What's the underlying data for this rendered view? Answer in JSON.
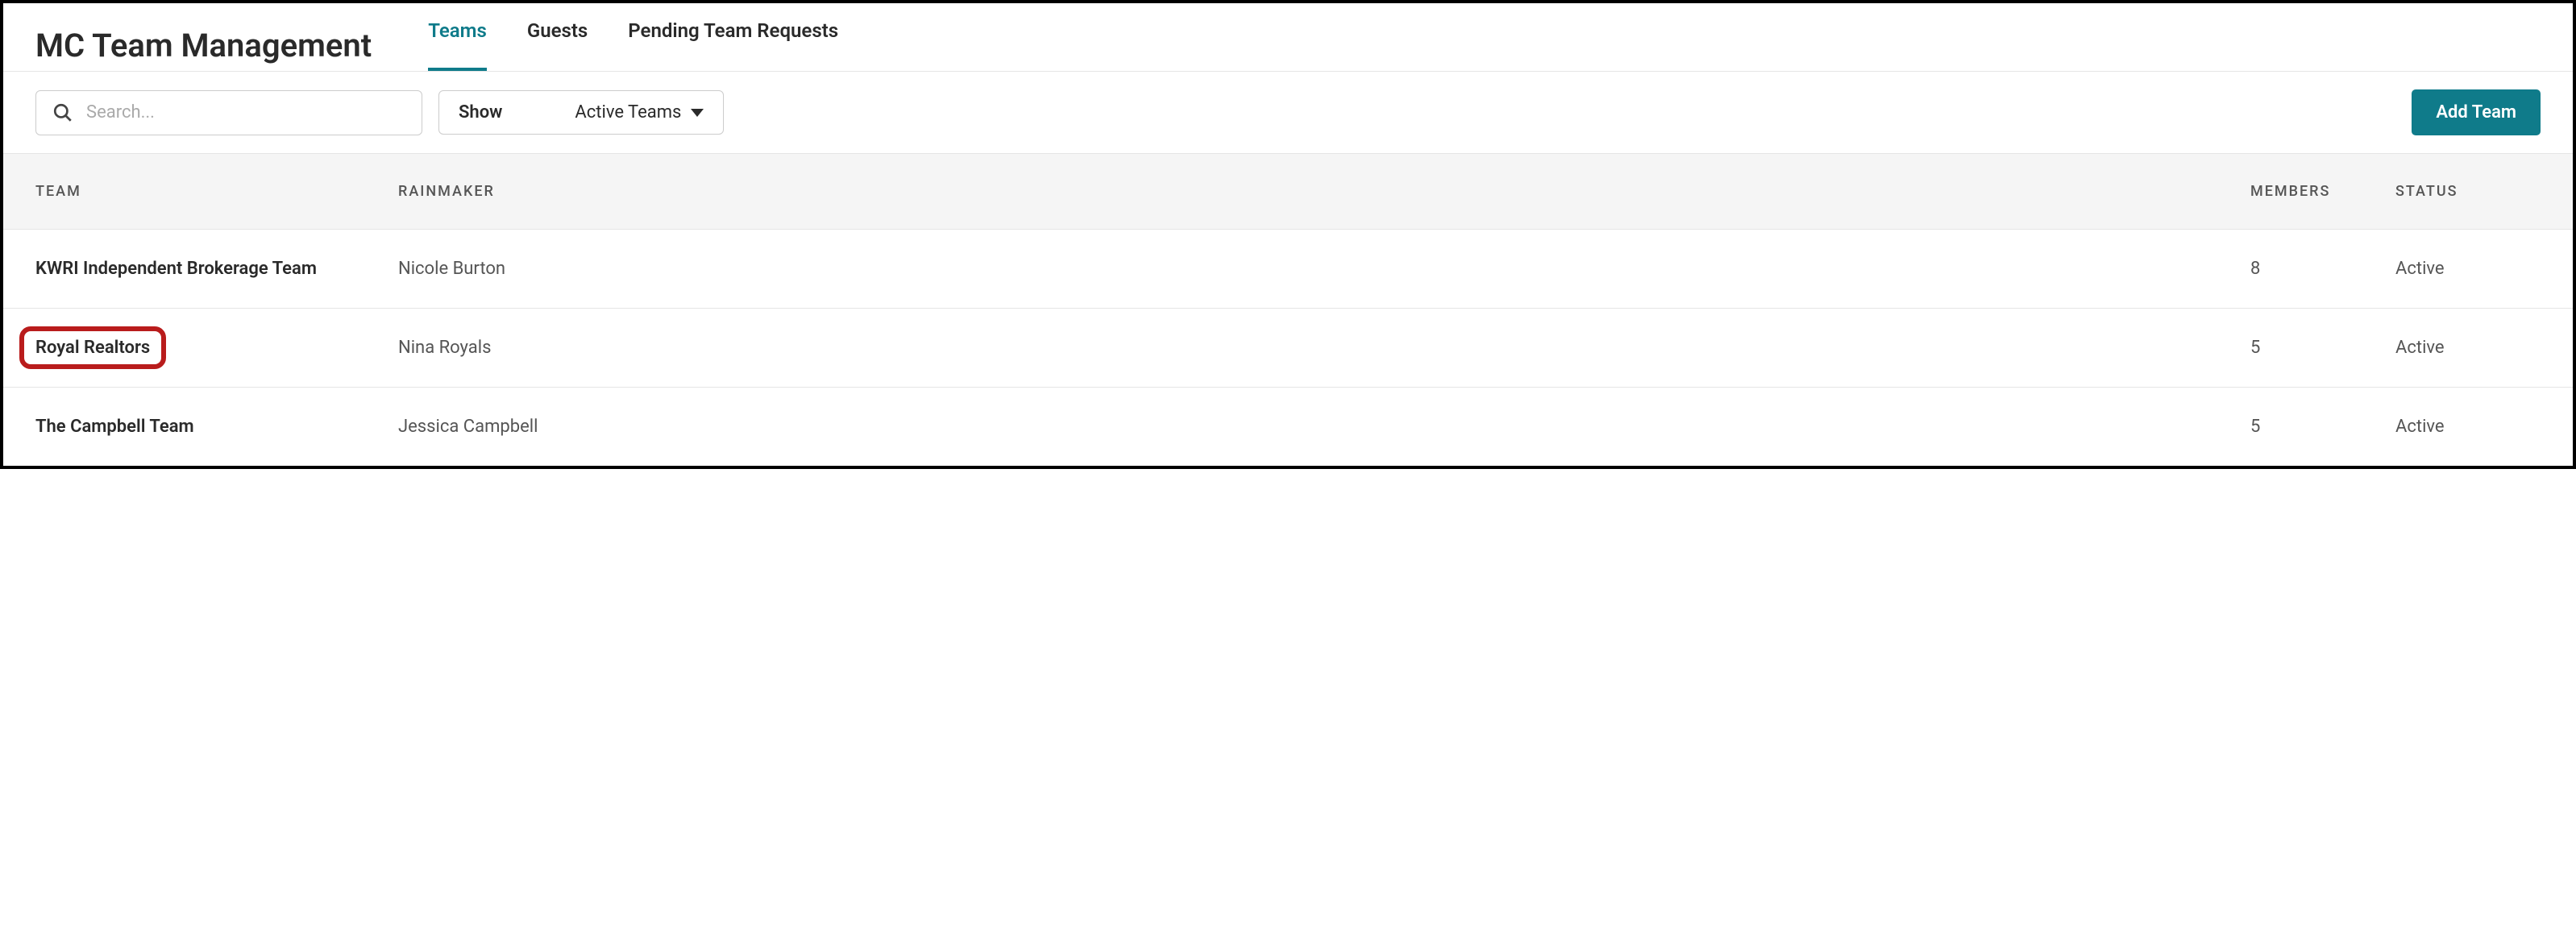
{
  "header": {
    "title": "MC Team Management",
    "tabs": [
      {
        "label": "Teams",
        "active": true
      },
      {
        "label": "Guests",
        "active": false
      },
      {
        "label": "Pending Team Requests",
        "active": false
      }
    ]
  },
  "controls": {
    "search_placeholder": "Search...",
    "filter_label": "Show",
    "filter_value": "Active Teams",
    "add_button_label": "Add Team"
  },
  "table": {
    "columns": {
      "team": "TEAM",
      "rainmaker": "RAINMAKER",
      "members": "MEMBERS",
      "status": "STATUS"
    },
    "rows": [
      {
        "team": "KWRI Independent Brokerage Team",
        "rainmaker": "Nicole Burton",
        "members": "8",
        "status": "Active",
        "highlighted": false
      },
      {
        "team": "Royal Realtors",
        "rainmaker": "Nina Royals",
        "members": "5",
        "status": "Active",
        "highlighted": true
      },
      {
        "team": "The Campbell Team",
        "rainmaker": "Jessica Campbell",
        "members": "5",
        "status": "Active",
        "highlighted": false
      }
    ]
  }
}
